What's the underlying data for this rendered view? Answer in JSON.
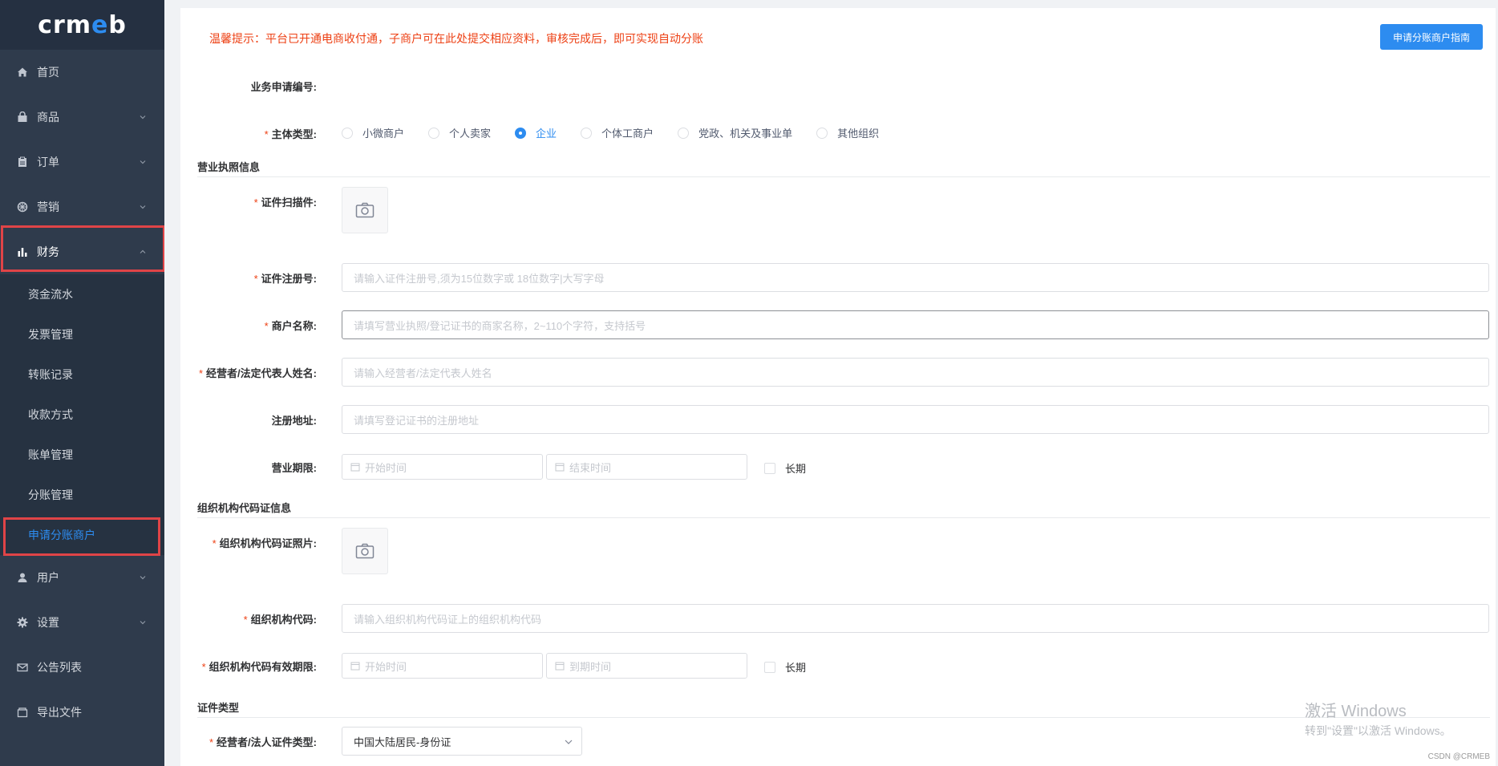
{
  "sidebar": {
    "logo": {
      "left": "crm",
      "e": "e",
      "right": "b"
    },
    "items": [
      {
        "label": "首页",
        "icon": "home-icon"
      },
      {
        "label": "商品",
        "icon": "bag-icon"
      },
      {
        "label": "订单",
        "icon": "clipboard-icon"
      },
      {
        "label": "营销",
        "icon": "wheel-icon"
      },
      {
        "label": "财务",
        "icon": "bar-chart-icon"
      }
    ],
    "finance_sub": [
      {
        "label": "资金流水"
      },
      {
        "label": "发票管理"
      },
      {
        "label": "转账记录"
      },
      {
        "label": "收款方式"
      },
      {
        "label": "账单管理"
      },
      {
        "label": "分账管理"
      },
      {
        "label": "申请分账商户"
      }
    ],
    "items_after": [
      {
        "label": "用户",
        "icon": "user-icon"
      },
      {
        "label": "设置",
        "icon": "gear-icon"
      },
      {
        "label": "公告列表",
        "icon": "mail-icon"
      },
      {
        "label": "导出文件",
        "icon": "folder-icon"
      }
    ]
  },
  "main": {
    "tip": "温馨提示：平台已开通电商收付通，子商户可在此处提交相应资料，审核完成后，即可实现自动分账",
    "guide_button": "申请分账商户指南",
    "biz_no_label": "业务申请编号:",
    "subject_type": {
      "label": "主体类型:",
      "options": [
        "小微商户",
        "个人卖家",
        "企业",
        "个体工商户",
        "党政、机关及事业单",
        "其他组织"
      ],
      "selected": "企业"
    },
    "license_section": "营业执照信息",
    "license_scan_label": "证件扫描件:",
    "reg_no": {
      "label": "证件注册号:",
      "placeholder": "请输入证件注册号,须为15位数字或 18位数字|大写字母"
    },
    "merchant_name": {
      "label": "商户名称:",
      "placeholder": "请填写营业执照/登记证书的商家名称，2~110个字符，支持括号"
    },
    "legal_name": {
      "label": "经营者/法定代表人姓名:",
      "placeholder": "请输入经营者/法定代表人姓名"
    },
    "reg_address": {
      "label": "注册地址:",
      "placeholder": "请填写登记证书的注册地址"
    },
    "biz_period": {
      "label": "营业期限:",
      "start": "开始时间",
      "end": "结束时间",
      "long": "长期"
    },
    "org_section": "组织机构代码证信息",
    "org_photo_label": "组织机构代码证照片:",
    "org_code": {
      "label": "组织机构代码:",
      "placeholder": "请输入组织机构代码证上的组织机构代码"
    },
    "org_period": {
      "label": "组织机构代码有效期限:",
      "start": "开始时间",
      "end": "到期时间",
      "long": "长期"
    },
    "id_section": "证件类型",
    "id_type": {
      "label": "经营者/法人证件类型:",
      "value": "中国大陆居民-身份证"
    }
  },
  "watermark": {
    "line1": "激活 Windows",
    "line2": "转到\"设置\"以激活 Windows。"
  },
  "credit": "CSDN @CRMEB",
  "colors": {
    "primary": "#2d8cf0",
    "danger": "#ed4014",
    "sidebar": "#2f3b4c"
  }
}
